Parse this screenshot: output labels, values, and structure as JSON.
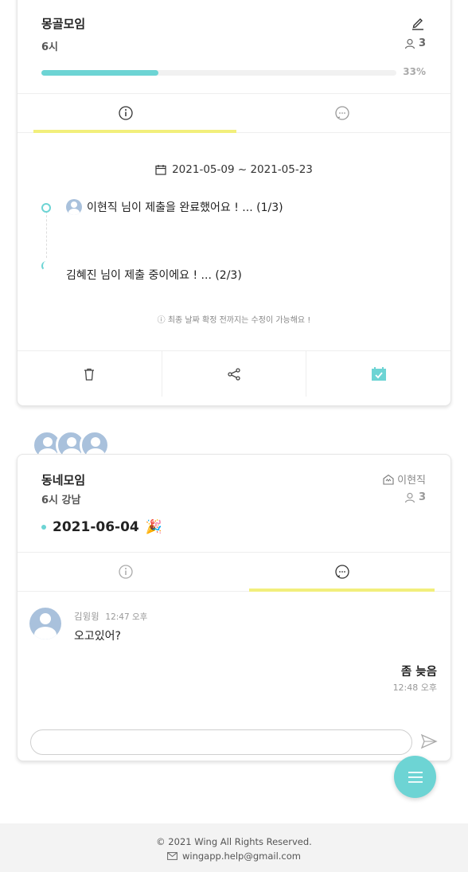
{
  "card1": {
    "title": "몽골모임",
    "time": "6시",
    "member_count": "3",
    "progress_percent": 33,
    "progress_label": "33%",
    "active_tab": "info",
    "date_range": "2021-05-09 ~ 2021-05-23",
    "timeline": [
      {
        "text": "이현직 님이 제출을 완료했어요 ! ... (1/3)",
        "state": "done"
      },
      {
        "text": "김혜진 님이 제출 중이에요 ! ... (2/3)",
        "state": "in-progress"
      }
    ],
    "notice": "ⓘ 최종 날짜 확정 전까지는 수정이 가능해요 !",
    "actions": [
      "trash-icon",
      "share-icon",
      "calendar-check-icon"
    ]
  },
  "card2": {
    "title": "동네모임",
    "time_place": "6시 강남",
    "owner": "이현직",
    "member_count": "3",
    "date": "2021-06-04",
    "date_emoji": "🎉",
    "active_tab": "chat",
    "messages": [
      {
        "sender": "김윙윙",
        "time": "12:47 오후",
        "text": "오고있어?",
        "side": "left"
      },
      {
        "text": "좀 늦음",
        "time": "12:48 오후",
        "side": "right"
      }
    ],
    "input_placeholder": ""
  },
  "footer": {
    "copyright": "© 2021 Wing All Rights Reserved.",
    "email": "wingapp.help@gmail.com"
  },
  "colors": {
    "accent": "#6dd4d4",
    "tab_underline": "#f2ef7c",
    "avatar": "#a9c1dc"
  }
}
